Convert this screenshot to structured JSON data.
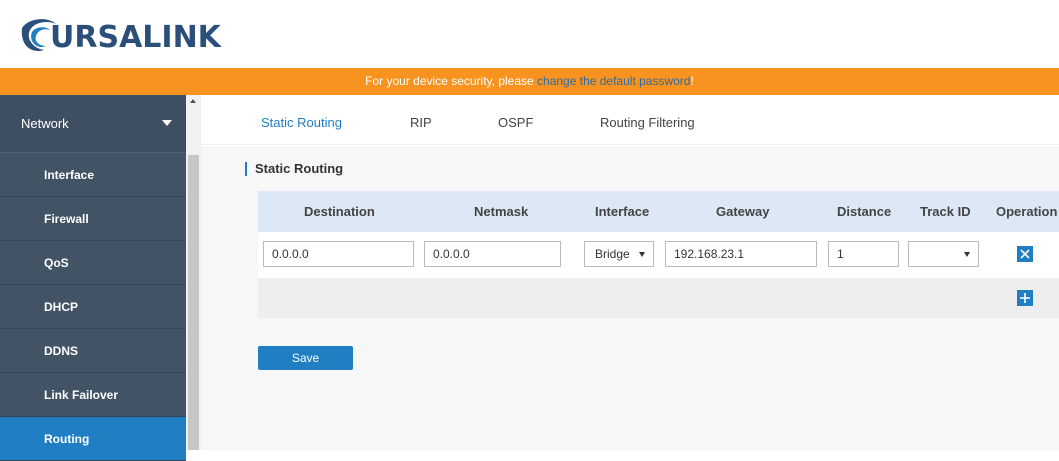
{
  "brand": {
    "name": "URSALINK"
  },
  "banner": {
    "prefix": "For your device security, please ",
    "link": "change the default password",
    "suffix": "!"
  },
  "sidebar": {
    "header": "Network",
    "items": [
      {
        "label": "Interface"
      },
      {
        "label": "Firewall"
      },
      {
        "label": "QoS"
      },
      {
        "label": "DHCP"
      },
      {
        "label": "DDNS"
      },
      {
        "label": "Link Failover"
      },
      {
        "label": "Routing"
      }
    ]
  },
  "tabs": [
    {
      "label": "Static Routing"
    },
    {
      "label": "RIP"
    },
    {
      "label": "OSPF"
    },
    {
      "label": "Routing Filtering"
    }
  ],
  "section": {
    "title": "Static Routing"
  },
  "table": {
    "headers": [
      "Destination",
      "Netmask",
      "Interface",
      "Gateway",
      "Distance",
      "Track ID",
      "Operation"
    ],
    "row": {
      "destination": "0.0.0.0",
      "netmask": "0.0.0.0",
      "interface": "Bridge",
      "gateway": "192.168.23.1",
      "distance": "1",
      "track_id": ""
    }
  },
  "actions": {
    "save": "Save"
  },
  "colors": {
    "accent": "#1f7fc2",
    "banner": "#f7931e",
    "sidebar": "#3d4f60"
  }
}
